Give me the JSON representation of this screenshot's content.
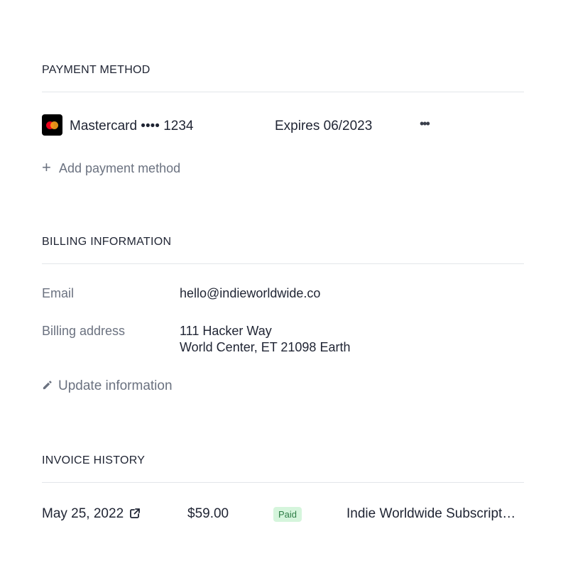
{
  "payment_method": {
    "title": "PAYMENT METHOD",
    "card": {
      "brand": "Mastercard",
      "masked_number": "Mastercard •••• 1234",
      "expiry": "Expires 06/2023",
      "menu_label": "•••",
      "icon": "mastercard-logo"
    },
    "add_label": "Add payment method",
    "add_icon": "plus-icon"
  },
  "billing": {
    "title": "BILLING INFORMATION",
    "email_label": "Email",
    "email_value": "hello@indieworldwide.co",
    "address_label": "Billing address",
    "address_line1": "111 Hacker Way",
    "address_line2": "World Center, ET 21098 Earth",
    "update_label": "Update information",
    "update_icon": "pencil-icon"
  },
  "invoices": {
    "title": "INVOICE HISTORY",
    "rows": [
      {
        "date": "May 25, 2022",
        "amount": "$59.00",
        "status": "Paid",
        "description": "Indie Worldwide Subscript…",
        "link_icon": "external-link-icon"
      }
    ]
  },
  "colors": {
    "text": "#1f2433",
    "muted": "#6b7280",
    "divider": "#e3e6ea",
    "badge_bg": "#d5f5dc",
    "badge_text": "#2e7d46"
  }
}
